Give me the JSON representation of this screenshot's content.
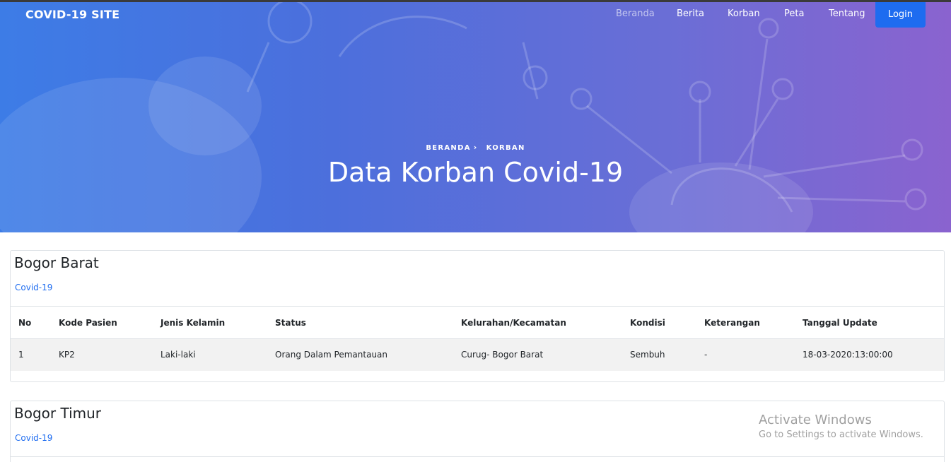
{
  "brand": "COVID-19 SITE",
  "nav": [
    {
      "label": "Beranda",
      "active": true
    },
    {
      "label": "Berita",
      "active": false
    },
    {
      "label": "Korban",
      "active": false
    },
    {
      "label": "Peta",
      "active": false
    },
    {
      "label": "Tentang",
      "active": false
    }
  ],
  "login_label": "Login",
  "breadcrumb": {
    "home": "BERANDA",
    "current": "KORBAN"
  },
  "hero_title": "Data Korban Covid-19",
  "colors": {
    "accent": "#1e6cf0",
    "hero_start": "#3d7ce6",
    "hero_end": "#8a63cf"
  },
  "table_headers": [
    "No",
    "Kode Pasien",
    "Jenis Kelamin",
    "Status",
    "Kelurahan/Kecamatan",
    "Kondisi",
    "Keterangan",
    "Tanggal Update"
  ],
  "cards": [
    {
      "title": "Bogor Barat",
      "subtitle": "Covid-19",
      "rows": [
        [
          "1",
          "KP2",
          "Laki-laki",
          "Orang Dalam Pemantauan",
          "Curug- Bogor Barat",
          "Sembuh",
          "-",
          "18-03-2020:13:00:00"
        ]
      ]
    },
    {
      "title": "Bogor Timur",
      "subtitle": "Covid-19",
      "rows": []
    }
  ],
  "watermark": {
    "line1": "Activate Windows",
    "line2": "Go to Settings to activate Windows."
  }
}
